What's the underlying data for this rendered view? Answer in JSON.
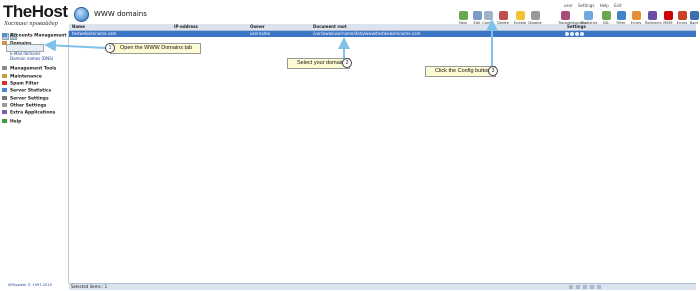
{
  "logo": {
    "main": "TheHost",
    "sub": "Хостинг провайдер"
  },
  "module": {
    "title": "WWW domains"
  },
  "topbar": {
    "user": "user",
    "settings": "Settings",
    "help": "Help",
    "exit": "Exit"
  },
  "toolbar": [
    {
      "label": "New",
      "icon": "new-icon",
      "color": "#6aa84f"
    },
    {
      "label": "Edit",
      "icon": "edit-icon",
      "color": "#7a9cc6"
    },
    {
      "label": "Config",
      "icon": "config-icon",
      "color": "#9fb4cc"
    },
    {
      "label": "Delete",
      "icon": "delete-icon",
      "color": "#c0504d"
    },
    {
      "label": "Enable",
      "icon": "enable-icon",
      "color": "#f1c232"
    },
    {
      "label": "Disable",
      "icon": "disable-icon",
      "color": "#999999"
    },
    {
      "label": "Troubleshooting",
      "icon": "troubleshoot-icon",
      "color": "#a64d79"
    },
    {
      "label": "Statistics",
      "icon": "statistics-icon",
      "color": "#6fa8dc"
    },
    {
      "label": "SSL",
      "icon": "ssl-icon",
      "color": "#6aa84f"
    },
    {
      "label": "Filter",
      "icon": "filter-icon",
      "color": "#3d85c6"
    },
    {
      "label": "Errors",
      "icon": "errors-icon",
      "color": "#e69138"
    },
    {
      "label": "Redirects",
      "icon": "redirects-icon",
      "color": "#674ea7"
    },
    {
      "label": "MIME",
      "icon": "mime-icon",
      "color": "#cc0000"
    },
    {
      "label": "Errors",
      "icon": "errors-icon",
      "color": "#cc4125"
    },
    {
      "label": "Back",
      "icon": "back-icon",
      "color": "#3d6fb0"
    }
  ],
  "sidebar": {
    "sections": [
      {
        "label": "Accounts Management",
        "icon": "accounts-icon",
        "color": "#5b8bd0"
      },
      {
        "label": "Domains",
        "icon": "domains-icon",
        "color": "#d98c3a"
      },
      {
        "label": "Management Tools",
        "icon": "tools-icon",
        "color": "#8a8a8a"
      },
      {
        "label": "Maintenance",
        "icon": "maintenance-icon",
        "color": "#c9a13b"
      },
      {
        "label": "Spam Filter",
        "icon": "spam-filter-icon",
        "color": "#cc3333"
      },
      {
        "label": "Server Statistics",
        "icon": "statistics-icon",
        "color": "#4a86c8"
      },
      {
        "label": "Server Settings",
        "icon": "settings-icon",
        "color": "#777777"
      },
      {
        "label": "Other Settings",
        "icon": "other-settings-icon",
        "color": "#9b9b9b"
      },
      {
        "label": "Extra Applications",
        "icon": "applications-icon",
        "color": "#7a5fb0"
      },
      {
        "label": "Help",
        "icon": "help-icon",
        "color": "#3d9a3d"
      }
    ],
    "domain_items": [
      "WWW domains",
      "E-Mail domains",
      "Domain names (DNS)"
    ],
    "footer": "ISPsystem © 1997-2010"
  },
  "grid": {
    "headers": [
      "Name",
      "IP-address",
      "Owner",
      "Document root",
      "Settings"
    ],
    "row": {
      "name": "testwebsitename.com",
      "ip": "",
      "owner": "username",
      "root": "/var/www/username/data/www/testwebsitename.com"
    }
  },
  "status": {
    "text": "Selected items : 1"
  },
  "callouts": [
    {
      "number": "1",
      "text": "Open the WWW Domains tab"
    },
    {
      "number": "2",
      "text": "Select your domain"
    },
    {
      "number": "3",
      "text": "Click the Config button"
    }
  ]
}
